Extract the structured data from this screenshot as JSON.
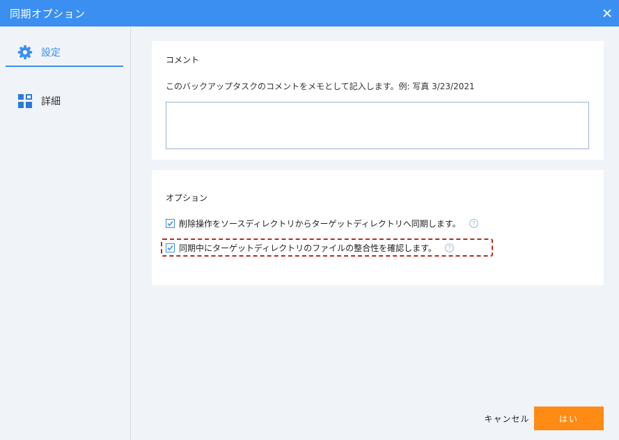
{
  "window": {
    "title": "同期オプション",
    "close_icon": "close-icon",
    "accent_color": "#3a8ff0"
  },
  "sidebar": {
    "items": [
      {
        "label": "設定",
        "icon": "gear-icon",
        "active": true
      },
      {
        "label": "詳細",
        "icon": "grid-icon",
        "active": false
      }
    ]
  },
  "comment": {
    "heading": "コメント",
    "description": "このバックアップタスクのコメントをメモとして記入します。例: 写真 3/23/2021",
    "value": ""
  },
  "options": {
    "heading": "オプション",
    "items": [
      {
        "label": "削除操作をソースディレクトリからターゲットディレクトリへ同期します。",
        "checked": true,
        "help_icon": "help-icon"
      },
      {
        "label": "同期中にターゲットディレクトリのファイルの整合性を確認します。",
        "checked": true,
        "help_icon": "help-icon",
        "highlighted": true
      }
    ]
  },
  "footer": {
    "cancel_label": "キャンセル",
    "ok_label": "はい",
    "ok_color": "#ff8a14"
  }
}
